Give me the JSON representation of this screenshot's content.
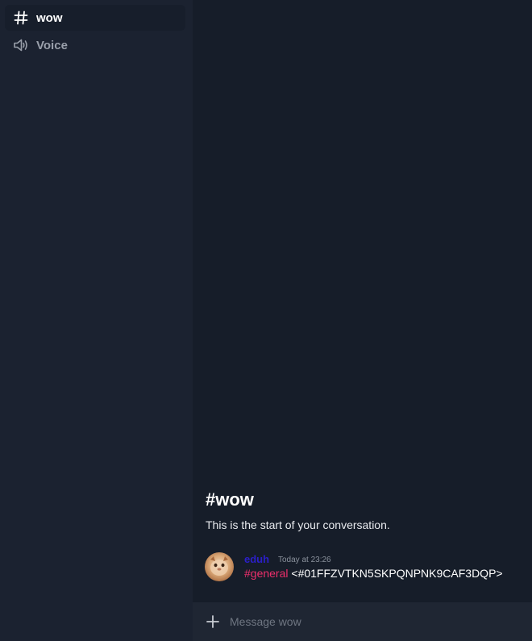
{
  "sidebar": {
    "channels": [
      {
        "label": "wow",
        "icon": "hash-icon",
        "active": true
      },
      {
        "label": "Voice",
        "icon": "speaker-icon",
        "active": false
      }
    ]
  },
  "conversation": {
    "title": "#wow",
    "subtitle": "This is the start of your conversation."
  },
  "messages": [
    {
      "author": "eduh",
      "author_color": "#2b1fc9",
      "timestamp": "Today at 23:26",
      "channel_mention": "#general",
      "text": "<#01FFZVTKN5SKPQNPNK9CAF3DQP>"
    }
  ],
  "composer": {
    "placeholder": "Message wow",
    "value": ""
  },
  "colors": {
    "sidebar_bg": "#1b2230",
    "main_bg": "#161d29",
    "mention": "#ee2f6c"
  }
}
